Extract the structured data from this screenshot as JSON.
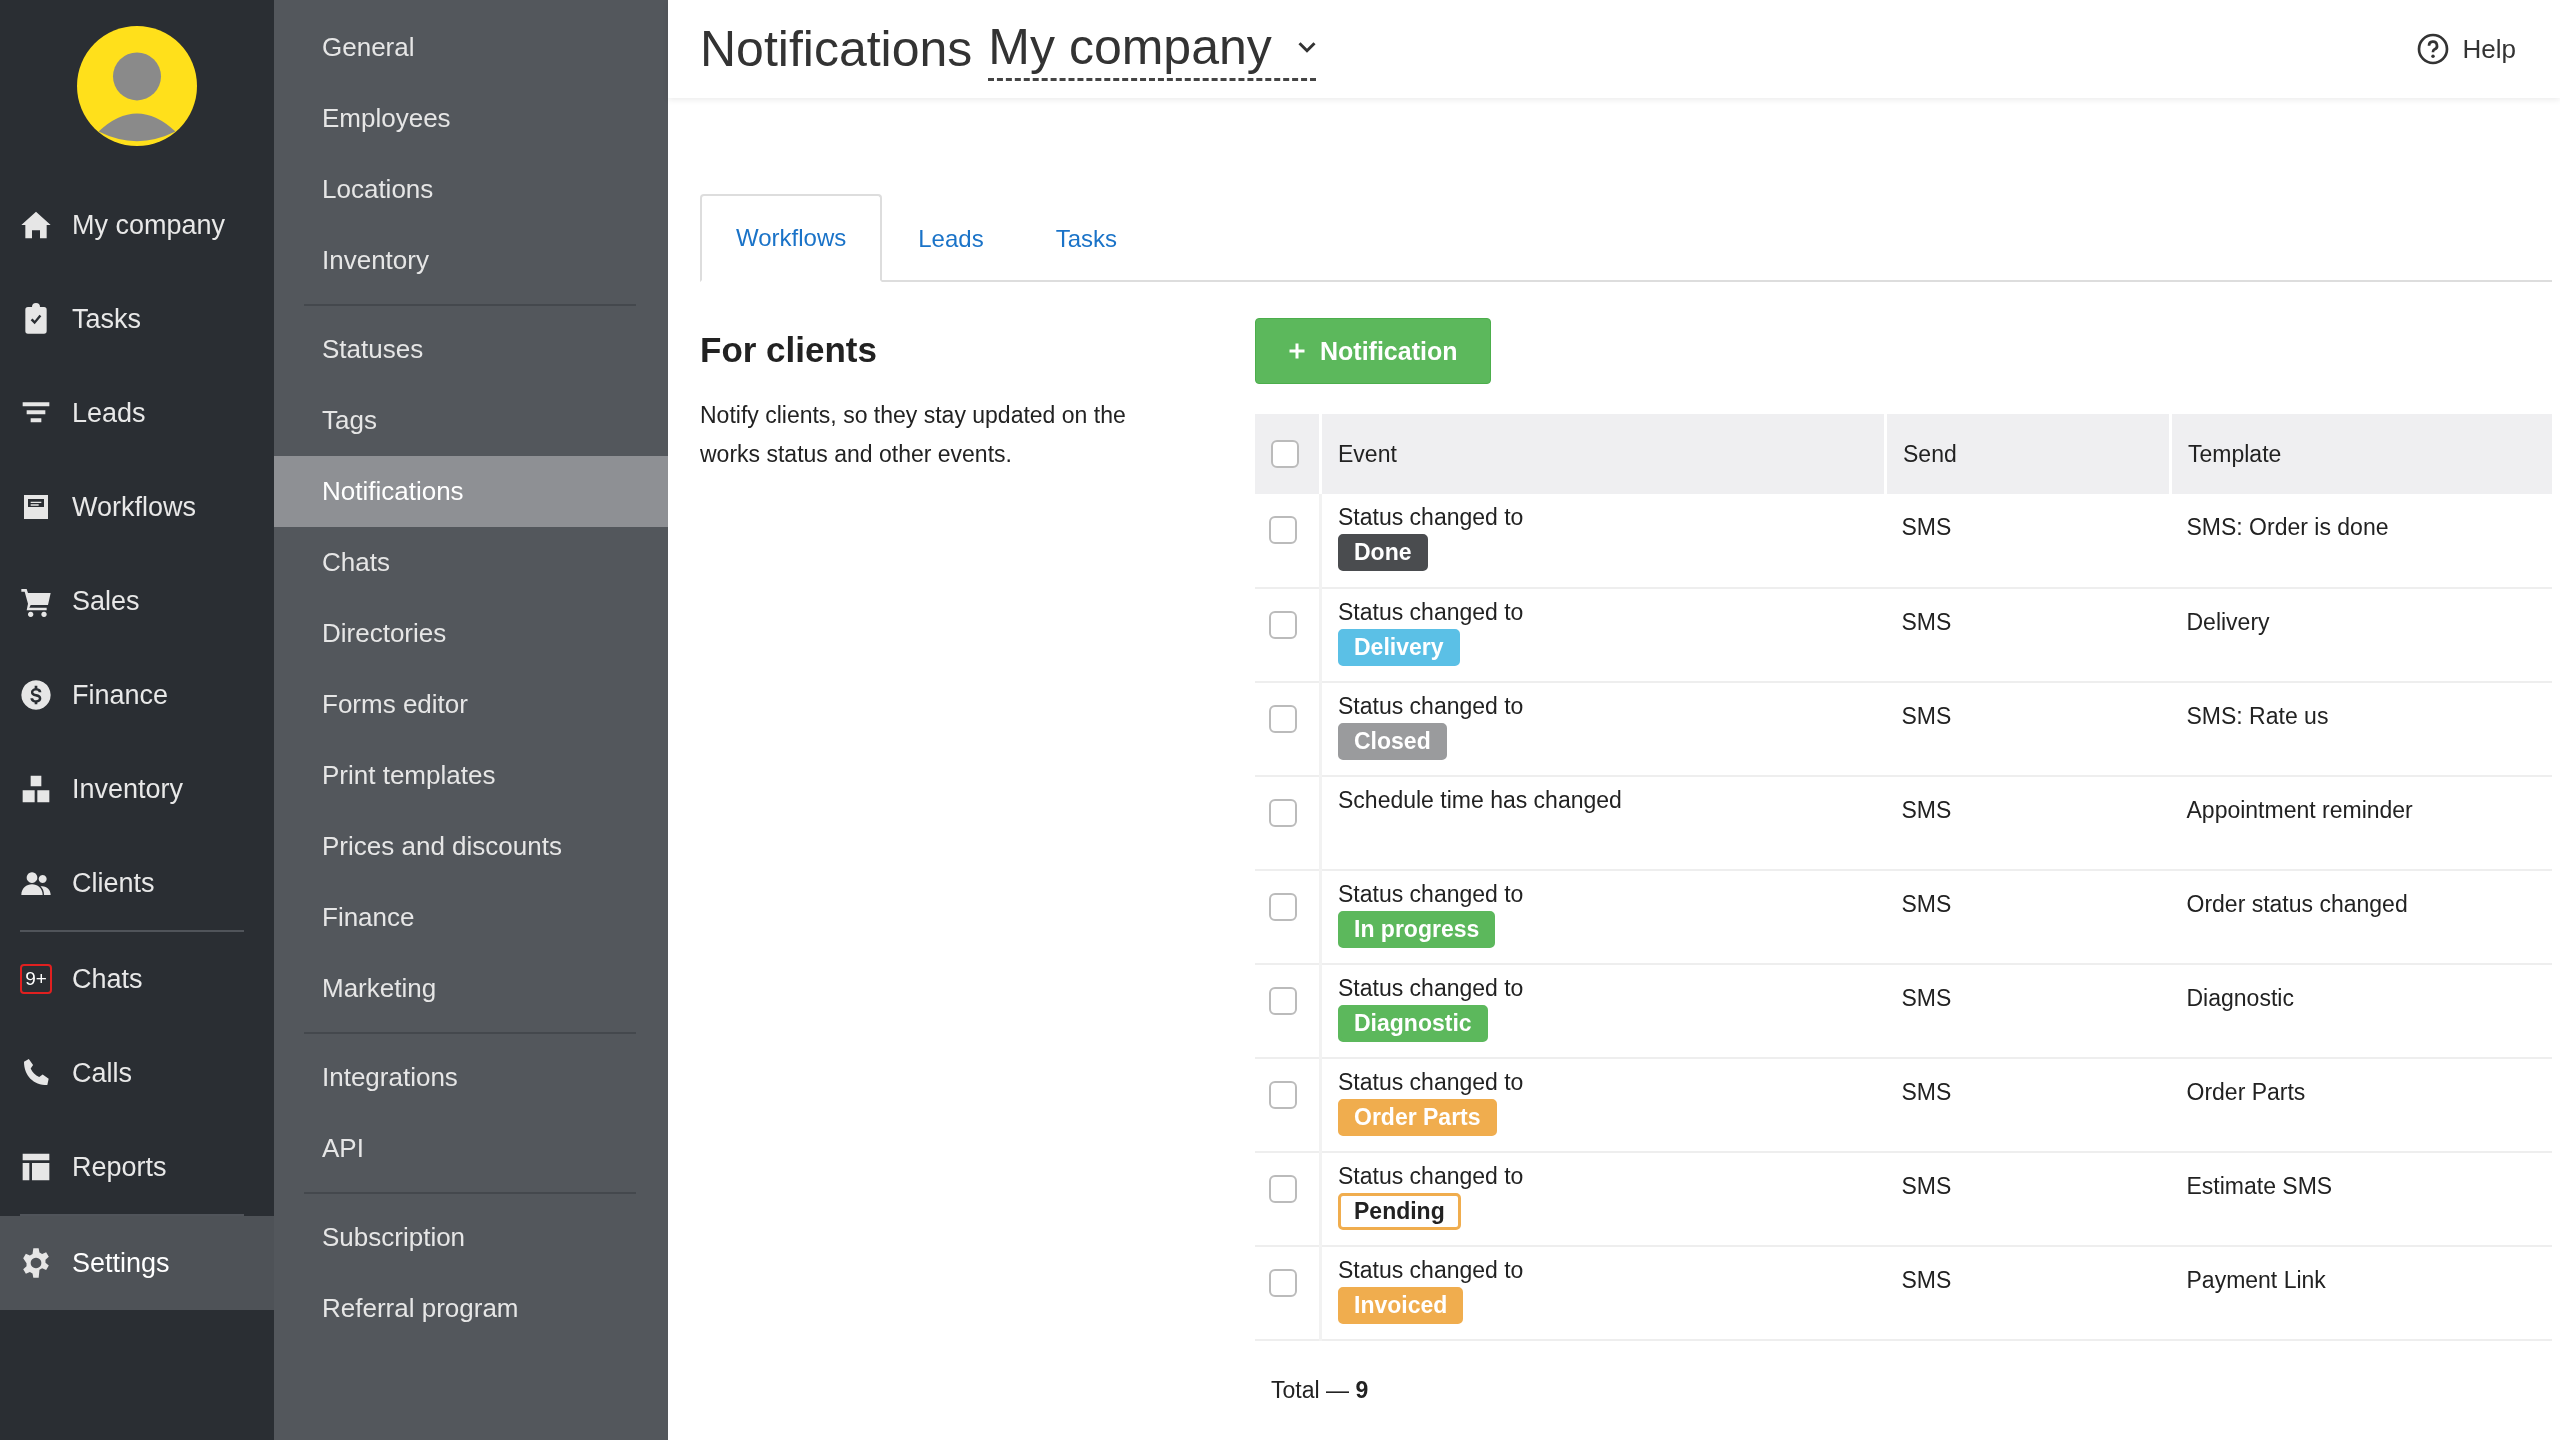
{
  "main_nav": [
    [
      {
        "label": "My company",
        "selected": false
      },
      {
        "label": "Tasks",
        "selected": false
      },
      {
        "label": "Leads",
        "selected": false
      },
      {
        "label": "Workflows",
        "selected": false
      },
      {
        "label": "Sales",
        "selected": false
      },
      {
        "label": "Finance",
        "selected": false
      },
      {
        "label": "Inventory",
        "selected": false
      },
      {
        "label": "Clients",
        "selected": false
      }
    ],
    [
      {
        "label": "Chats",
        "selected": false,
        "badge": "9+"
      },
      {
        "label": "Calls",
        "selected": false
      },
      {
        "label": "Reports",
        "selected": false
      }
    ],
    [
      {
        "label": "Settings",
        "selected": true
      }
    ]
  ],
  "settings_menu": [
    [
      {
        "label": "General",
        "selected": false
      },
      {
        "label": "Employees",
        "selected": false
      },
      {
        "label": "Locations",
        "selected": false
      },
      {
        "label": "Inventory",
        "selected": false
      }
    ],
    [
      {
        "label": "Statuses",
        "selected": false
      },
      {
        "label": "Tags",
        "selected": false
      },
      {
        "label": "Notifications",
        "selected": true
      },
      {
        "label": "Chats",
        "selected": false
      },
      {
        "label": "Directories",
        "selected": false
      },
      {
        "label": "Forms editor",
        "selected": false
      },
      {
        "label": "Print templates",
        "selected": false
      },
      {
        "label": "Prices and discounts",
        "selected": false
      },
      {
        "label": "Finance",
        "selected": false
      },
      {
        "label": "Marketing",
        "selected": false
      }
    ],
    [
      {
        "label": "Integrations",
        "selected": false
      },
      {
        "label": "API",
        "selected": false
      }
    ],
    [
      {
        "label": "Subscription",
        "selected": false
      },
      {
        "label": "Referral program",
        "selected": false
      }
    ]
  ],
  "header": {
    "title": "Notifications",
    "company": "My company",
    "help": "Help"
  },
  "tabs": [
    {
      "label": "Workflows",
      "selected": true
    },
    {
      "label": "Leads",
      "selected": false
    },
    {
      "label": "Tasks",
      "selected": false
    }
  ],
  "section": {
    "title": "For clients",
    "description": "Notify clients, so they stay updated on the works status and other events."
  },
  "add_button": "Notification",
  "table": {
    "all_checked": false,
    "columns": [
      "Event",
      "Send",
      "Template"
    ],
    "rows": [
      {
        "checked": false,
        "event": "Status changed to",
        "status": {
          "label": "Done",
          "color": "#4a4c4f",
          "outlined": false
        },
        "send": "SMS",
        "template": "SMS: Order is done"
      },
      {
        "checked": false,
        "event": "Status changed to",
        "status": {
          "label": "Delivery",
          "color": "#5bc0e6",
          "outlined": false
        },
        "send": "SMS",
        "template": "Delivery"
      },
      {
        "checked": false,
        "event": "Status changed to",
        "status": {
          "label": "Closed",
          "color": "#9a9b9d",
          "outlined": false
        },
        "send": "SMS",
        "template": "SMS: Rate us"
      },
      {
        "checked": false,
        "event": "Schedule time has changed",
        "send": "SMS",
        "template": "Appointment reminder"
      },
      {
        "checked": false,
        "event": "Status changed to",
        "status": {
          "label": "In progress",
          "color": "#5cb85c",
          "outlined": false
        },
        "send": "SMS",
        "template": "Order status changed"
      },
      {
        "checked": false,
        "event": "Status changed to",
        "status": {
          "label": "Diagnostic",
          "color": "#5cb85c",
          "outlined": false
        },
        "send": "SMS",
        "template": "Diagnostic"
      },
      {
        "checked": false,
        "event": "Status changed to",
        "status": {
          "label": "Order Parts",
          "color": "#f0ad4e",
          "outlined": false
        },
        "send": "SMS",
        "template": "Order Parts"
      },
      {
        "checked": false,
        "event": "Status changed to",
        "status": {
          "label": "Pending",
          "color": "#f0ad4e",
          "outlined": true
        },
        "send": "SMS",
        "template": "Estimate SMS"
      },
      {
        "checked": false,
        "event": "Status changed to",
        "status": {
          "label": "Invoiced",
          "color": "#f0ad4e",
          "outlined": false
        },
        "send": "SMS",
        "template": "Payment Link"
      }
    ]
  },
  "total": "Total — **9**"
}
